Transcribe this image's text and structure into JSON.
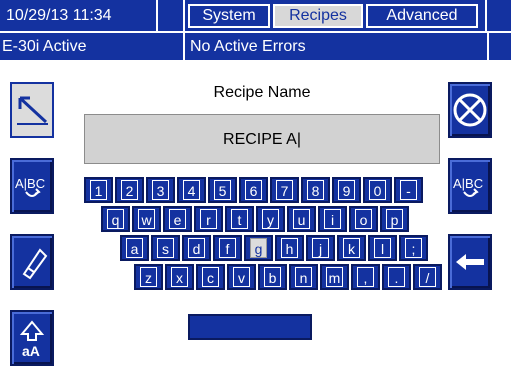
{
  "header": {
    "datetime": "10/29/13 11:34",
    "tabs": [
      {
        "label": "System",
        "active": false
      },
      {
        "label": "Recipes",
        "active": true
      },
      {
        "label": "Advanced",
        "active": false
      }
    ],
    "status_mode": "E-30i Active",
    "error_status": "No Active Errors"
  },
  "editor": {
    "caption": "Recipe Name",
    "value": "RECIPE A|"
  },
  "side_buttons": {
    "left": [
      {
        "name": "cancel-edit-icon",
        "pressed": true
      },
      {
        "name": "spell-case-toggle-icon",
        "label": "A|BC"
      },
      {
        "name": "eraser-icon"
      },
      {
        "name": "shift-case-icon",
        "label": "aA"
      }
    ],
    "right": [
      {
        "name": "clear-field-icon"
      },
      {
        "name": "spell-case-toggle-icon",
        "label": "A|BC"
      },
      {
        "name": "backspace-arrow-icon"
      }
    ]
  },
  "keyboard": {
    "rows": [
      [
        "1",
        "2",
        "3",
        "4",
        "5",
        "6",
        "7",
        "8",
        "9",
        "0",
        "-"
      ],
      [
        "q",
        "w",
        "e",
        "r",
        "t",
        "y",
        "u",
        "i",
        "o",
        "p"
      ],
      [
        "a",
        "s",
        "d",
        "f",
        "g",
        "h",
        "j",
        "k",
        "l",
        ";"
      ],
      [
        "z",
        "x",
        "c",
        "v",
        "b",
        "n",
        "m",
        ",",
        ".",
        "/"
      ]
    ],
    "selected_key": "g",
    "space_label": ""
  },
  "colors": {
    "accent": "#1432a0",
    "selected": "#dcdcdc",
    "field_bg": "#d2d2d2"
  }
}
